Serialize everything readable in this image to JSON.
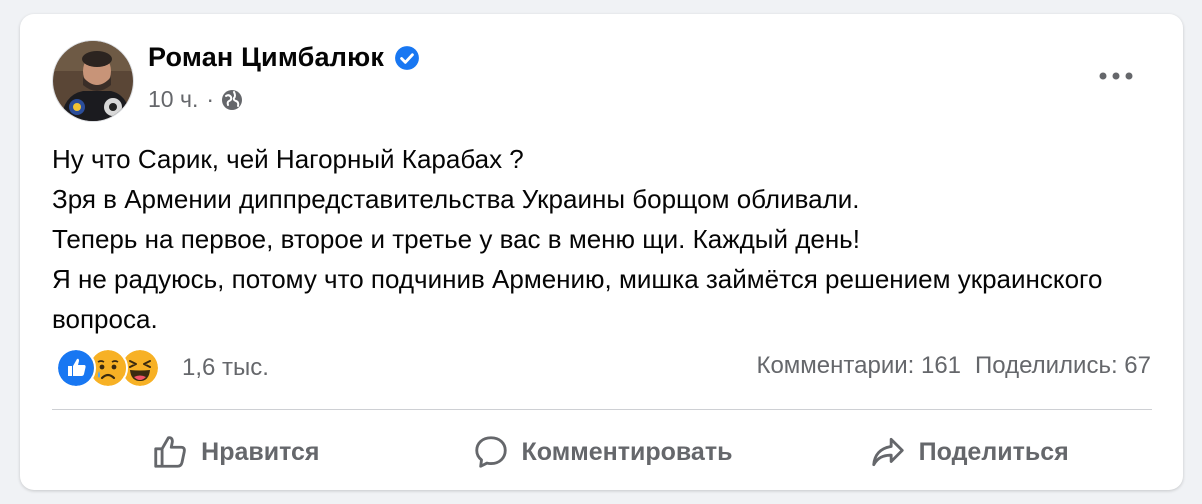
{
  "post": {
    "author_name": "Роман Цимбалюк",
    "time": "10 ч.",
    "separator": "·",
    "lines": [
      "Ну что Сарик, чей Нагорный Карабах ?",
      "Зря в Армении диппредставительства Украины борщом обливали.",
      "Теперь на первое, второе и третье у вас в меню щи. Каждый день!",
      "Я не радуюсь, потому что подчинив Армению, мишка займётся решением украинского вопроса."
    ]
  },
  "reactions": {
    "icons": [
      "like-icon",
      "sad-icon",
      "haha-icon"
    ],
    "count": "1,6 тыс."
  },
  "stats": {
    "comments": "Комментарии: 161",
    "shares": "Поделились: 67"
  },
  "actions": {
    "like": "Нравится",
    "comment": "Комментировать",
    "share": "Поделиться"
  },
  "colors": {
    "like_blue": "#1877f2",
    "reaction_yellow": "#f7b125",
    "secondary_text": "#65676b"
  }
}
